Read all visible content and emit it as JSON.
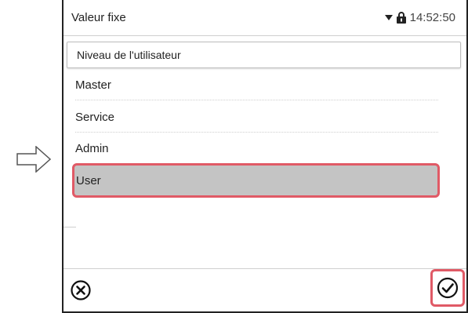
{
  "statusbar": {
    "title": "Valeur fixe",
    "time": "14:52:50",
    "icons": [
      "dropdown-arrow-icon",
      "lock-icon"
    ]
  },
  "list": {
    "header": "Niveau de l'utilisateur",
    "items": [
      {
        "label": "Master"
      },
      {
        "label": "Service"
      },
      {
        "label": "Admin"
      },
      {
        "label": "User",
        "selected": true
      }
    ]
  },
  "footer": {
    "cancel_icon": "cancel-circle-x-icon",
    "confirm_icon": "confirm-circle-check-icon"
  },
  "colors": {
    "highlight": "#e05a66",
    "selected_bg": "#c4c4c4"
  },
  "annotation": {
    "arrow_icon": "right-pointing-arrow-icon"
  }
}
